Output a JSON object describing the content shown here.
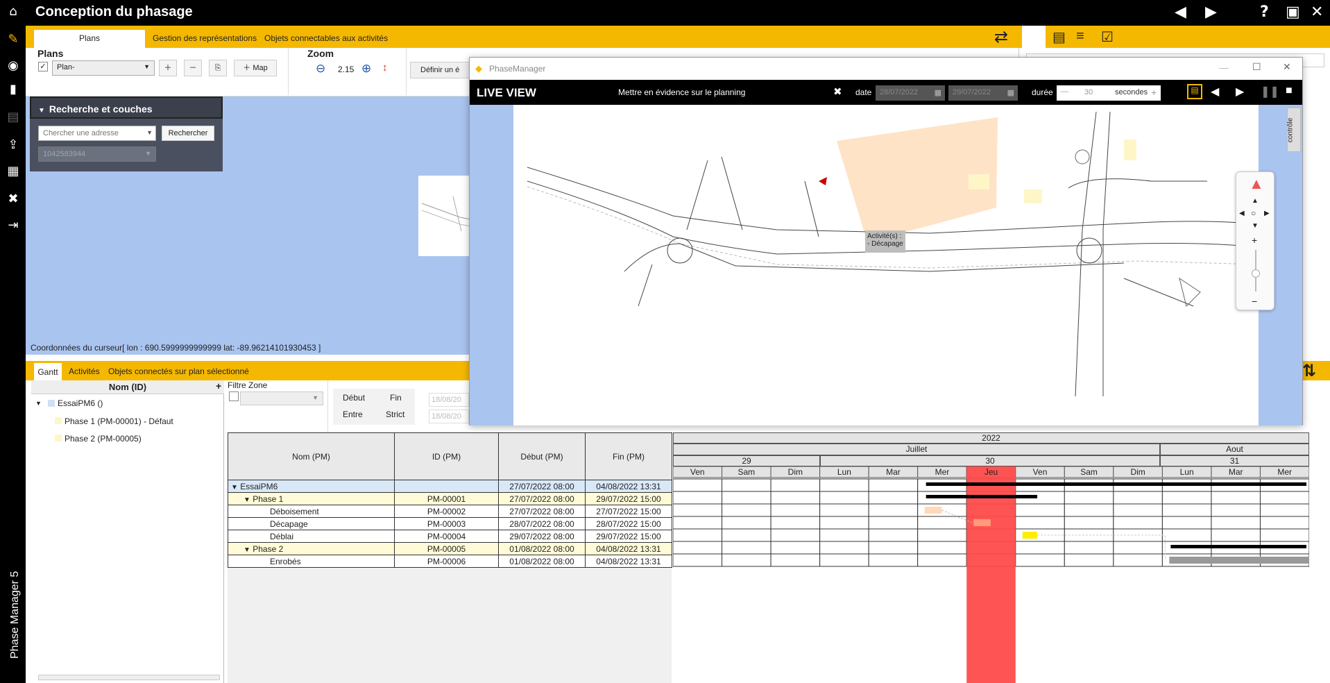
{
  "app": {
    "title": "Conception du phasage",
    "vertical_label": "Phase Manager 5"
  },
  "ribbon_tabs": [
    "Plans",
    "Gestion des représentations",
    "Objets connectables aux activités"
  ],
  "plans": {
    "label": "Plans",
    "selected": "Plan-",
    "map_button": "Map"
  },
  "zoom": {
    "label": "Zoom",
    "value": "2.15",
    "define_button": "Définir un é"
  },
  "search": {
    "title": "Recherche et couches",
    "placeholder": "Chercher une adresse",
    "button": "Rechercher",
    "layer_value": "1042583944"
  },
  "coords": "Coordonnées du curseur[ lon : 690.5999999999999 lat: -89.96214101930453 ]",
  "gantt_tabs": [
    "Gantt",
    "Activités",
    "Objets connectés sur plan sélectionné"
  ],
  "tree": {
    "header": "Nom (ID)",
    "root": "EssaiPM6 ()",
    "items": [
      "Phase 1 (PM-00001) - Défaut",
      "Phase 2 (PM-00005)"
    ]
  },
  "filter": {
    "label": "Filtre Zone",
    "debut": "Début",
    "fin": "Fin",
    "entre": "Entre",
    "strict": "Strict",
    "date1": "18/08/20",
    "date2": "18/08/20"
  },
  "table": {
    "headers": [
      "Nom (PM)",
      "ID (PM)",
      "Début (PM)",
      "Fin (PM)"
    ],
    "rows": [
      {
        "name": "EssaiPM6",
        "id": "",
        "start": "27/07/2022 08:00",
        "end": "04/08/2022 13:31"
      },
      {
        "name": "Phase 1",
        "id": "PM-00001",
        "start": "27/07/2022 08:00",
        "end": "29/07/2022 15:00"
      },
      {
        "name": "Déboisement",
        "id": "PM-00002",
        "start": "27/07/2022 08:00",
        "end": "27/07/2022 15:00"
      },
      {
        "name": "Décapage",
        "id": "PM-00003",
        "start": "28/07/2022 08:00",
        "end": "28/07/2022 15:00"
      },
      {
        "name": "Déblai",
        "id": "PM-00004",
        "start": "29/07/2022 08:00",
        "end": "29/07/2022 15:00"
      },
      {
        "name": "Phase 2",
        "id": "PM-00005",
        "start": "01/08/2022 08:00",
        "end": "04/08/2022 13:31"
      },
      {
        "name": "Enrobés",
        "id": "PM-00006",
        "start": "01/08/2022 08:00",
        "end": "04/08/2022 13:31"
      }
    ]
  },
  "gantt": {
    "year": "2022",
    "months": [
      "Juillet",
      "Aout"
    ],
    "weeks": [
      "29",
      "30",
      "31"
    ],
    "days": [
      "Ven",
      "Sam",
      "Dim",
      "Lun",
      "Mar",
      "Mer",
      "Jeu",
      "Ven",
      "Sam",
      "Dim",
      "Lun",
      "Mar",
      "Mer"
    ],
    "today_day_index": 6
  },
  "phasemanager": {
    "window_title": "PhaseManager",
    "live_view": "LIVE VIEW",
    "highlight": "Mettre en évidence sur le planning",
    "date_label": "date",
    "date_from": "28/07/2022",
    "date_to": "29/07/2022",
    "duree_label": "durée",
    "duree_value": "30",
    "seconds_label": "secondes",
    "tooltip_line1": "Activité(s) :",
    "tooltip_line2": "- Décapage",
    "controle_label": "contrôle"
  },
  "colors": {
    "accent": "#f5b800",
    "map": "#a9c4ef",
    "today": "#ff4b4b"
  }
}
